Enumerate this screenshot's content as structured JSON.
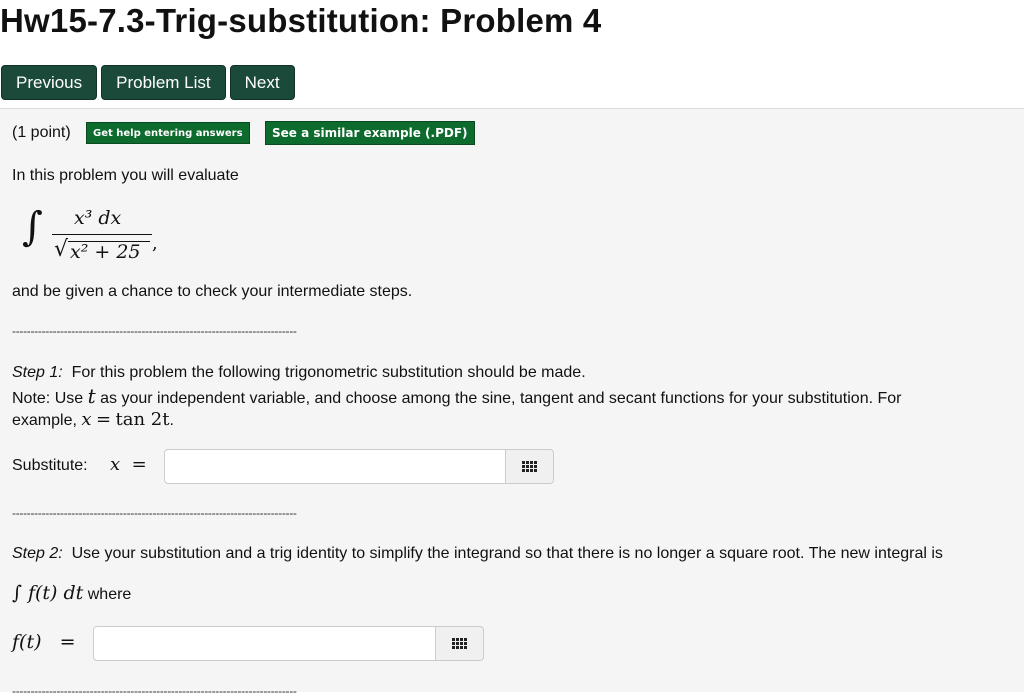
{
  "page": {
    "title": "Hw15-7.3-Trig-substitution: Problem 4"
  },
  "nav": {
    "previous": "Previous",
    "problem_list": "Problem List",
    "next": "Next"
  },
  "problem": {
    "points": "(1 point)",
    "help_entering": "Get help entering answers",
    "similar_example": "See a similar example (.PDF)",
    "intro": "In this problem you will evaluate",
    "integral": {
      "integral_sign": "∫",
      "numerator": "x³ dx",
      "denominator": "x² + 25",
      "trailing": ","
    },
    "outro": "and be given a chance to check your intermediate steps.",
    "rule": "-----------------------------------------------------------------------------"
  },
  "step1": {
    "label": "Step 1:",
    "text": "For this problem the following trigonometric substitution should be made.",
    "note_pre": "Note: Use",
    "note_var": "t",
    "note_post": "as your independent variable, and choose among the sine, tangent and secant functions for your substitution. For",
    "example_pre": "example,",
    "example_lhs": "x",
    "example_eq": "=",
    "example_rhs": "tan 2t",
    "example_end": ".",
    "substitute_label": "Substitute:",
    "sub_var": "x",
    "sub_eq": "=",
    "input_value": ""
  },
  "step2": {
    "label": "Step 2:",
    "text": "Use your substitution and a trig identity to simplify the integrand so that there is no longer a square root. The new integral is",
    "integral_expr": "∫ f(t) dt",
    "where": "where",
    "f_label": "f(t)",
    "f_eq": "=",
    "input_value": ""
  }
}
